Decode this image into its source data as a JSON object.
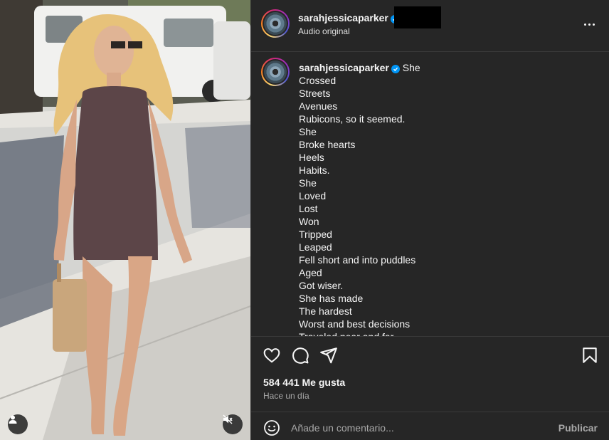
{
  "post": {
    "username": "sarahjessicaparker",
    "audio_label": "Audio original"
  },
  "caption": {
    "username": "sarahjessicaparker",
    "lines": [
      "She",
      "Crossed",
      "Streets",
      "Avenues",
      "Rubicons, so it seemed.",
      "She",
      "Broke hearts",
      "Heels",
      "Habits.",
      "She",
      "Loved",
      "Lost",
      "Won",
      "Tripped",
      "Leaped",
      "Fell short and into puddles",
      "Aged",
      "Got wiser.",
      "She has made",
      "The hardest",
      "Worst and best decisions",
      "Traveled near and far"
    ]
  },
  "engagement": {
    "likes": "584 441 Me gusta",
    "time": "Hace un día"
  },
  "comment": {
    "placeholder": "Añade un comentario...",
    "publish_label": "Publicar"
  },
  "icons": {
    "like": "heart-icon",
    "comment": "comment-icon",
    "share": "share-icon",
    "save": "bookmark-icon",
    "emoji": "emoji-icon",
    "more": "more-options-icon",
    "tagged": "user-tag-icon",
    "mute": "muted-icon",
    "verified": "verified-badge-icon"
  },
  "colors": {
    "panel_bg": "#262626",
    "verified": "#0095f6",
    "muted_text": "#a8a8a8"
  }
}
